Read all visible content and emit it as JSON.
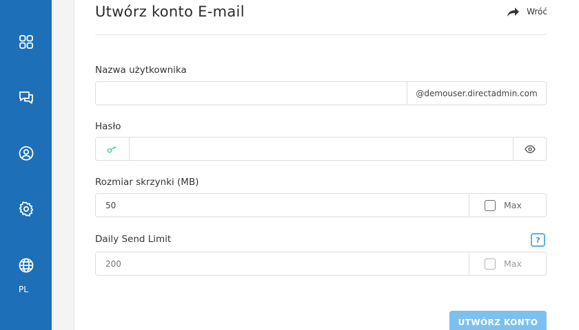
{
  "language": "PL",
  "colors": {
    "sidebar": "#1d70b8",
    "accent": "#7cc0ef",
    "help": "#3b8ed4"
  },
  "sidebar": {
    "items": [
      {
        "icon": "dashboard-grid-icon"
      },
      {
        "icon": "chat-bubbles-icon"
      },
      {
        "icon": "user-circle-icon"
      },
      {
        "icon": "gear-icon"
      },
      {
        "icon": "globe-icon"
      }
    ]
  },
  "header": {
    "title": "Utwórz konto E-mail",
    "back_label": "Wróć"
  },
  "form": {
    "username": {
      "label": "Nazwa użytkownika",
      "value": "",
      "suffix": "@demouser.directadmin.com"
    },
    "password": {
      "label": "Hasło",
      "value": ""
    },
    "mailbox_size": {
      "label": "Rozmiar skrzynki (MB)",
      "value": "50",
      "max_label": "Max",
      "max_checked": false
    },
    "send_limit": {
      "label": "Daily Send Limit",
      "placeholder": "200",
      "max_label": "Max",
      "max_checked": false,
      "help": "?"
    },
    "submit_label": "UTWÓRZ KONTO"
  }
}
